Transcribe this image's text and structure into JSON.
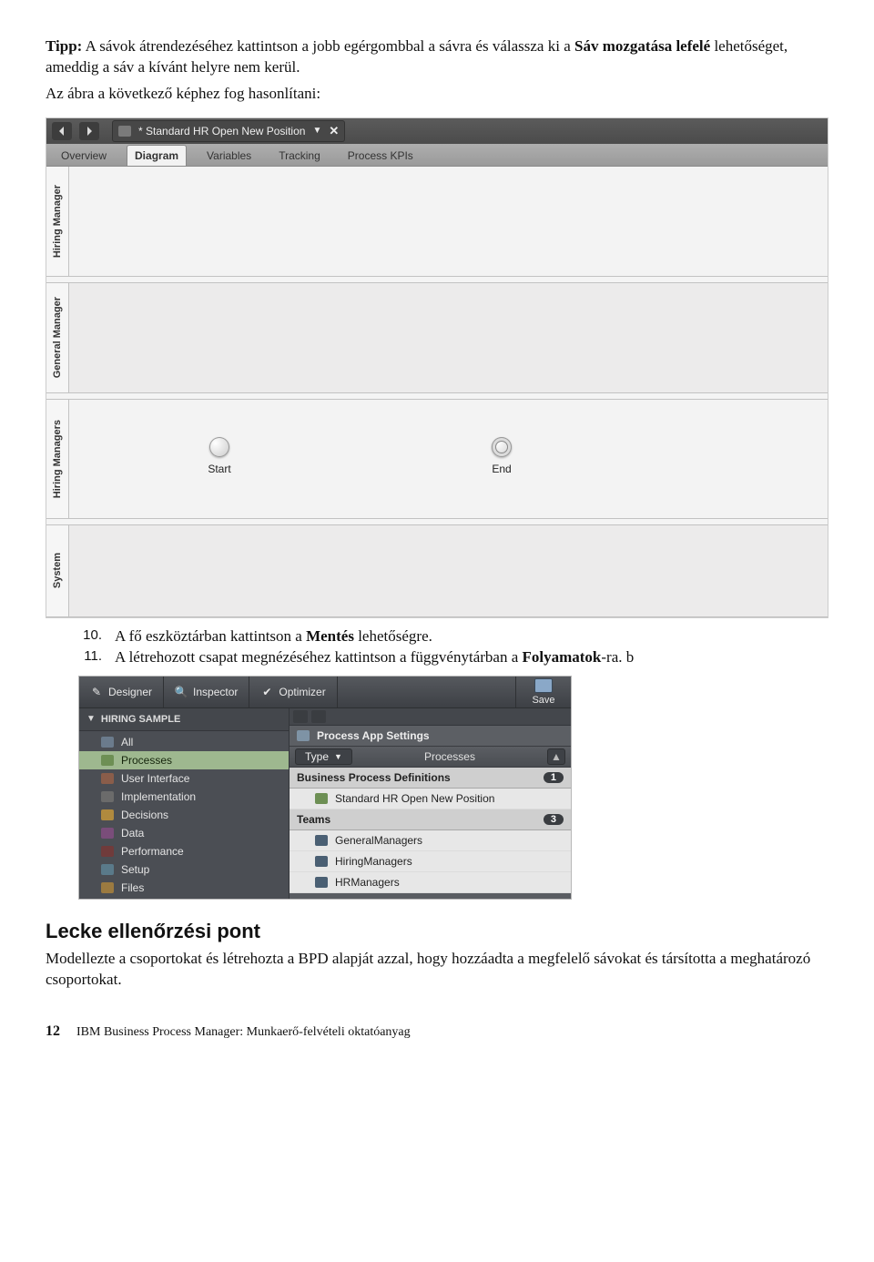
{
  "tip": {
    "label": "Tipp:",
    "before": "A sávok átrendezéséhez kattintson a jobb egérgombbal a sávra és válassza ki a ",
    "bold": "Sáv mozgatása lefelé",
    "after": " lehetőséget, ameddig a sáv a kívánt helyre nem kerül."
  },
  "intro": "Az ábra a következő képhez fog hasonlítani:",
  "shot1": {
    "tabTitle": "* Standard HR Open New Position",
    "subtabs": [
      "Overview",
      "Diagram",
      "Variables",
      "Tracking",
      "Process KPIs"
    ],
    "activeSubtab": "Diagram",
    "lanes": [
      "Hiring Manager",
      "General Manager",
      "Hiring Managers",
      "System"
    ],
    "nodes": {
      "start": "Start",
      "end": "End"
    }
  },
  "steps": [
    {
      "n": "10.",
      "before": "A fő eszköztárban kattintson a ",
      "bold": "Mentés",
      "after": " lehetőségre."
    },
    {
      "n": "11.",
      "before": "A létrehozott csapat megnézéséhez kattintson a függvénytárban a ",
      "bold": "Folyamatok",
      "after": "-ra. b"
    }
  ],
  "shot2": {
    "top": {
      "designer": "Designer",
      "inspector": "Inspector",
      "optimizer": "Optimizer",
      "save": "Save"
    },
    "lib": {
      "header": "HIRING SAMPLE",
      "items": [
        {
          "label": "All",
          "iconClass": "c-all"
        },
        {
          "label": "Processes",
          "iconClass": "c-proc",
          "selected": true
        },
        {
          "label": "User Interface",
          "iconClass": "c-ui"
        },
        {
          "label": "Implementation",
          "iconClass": "c-impl"
        },
        {
          "label": "Decisions",
          "iconClass": "c-dec"
        },
        {
          "label": "Data",
          "iconClass": "c-data"
        },
        {
          "label": "Performance",
          "iconClass": "c-perf"
        },
        {
          "label": "Setup",
          "iconClass": "c-setup"
        },
        {
          "label": "Files",
          "iconClass": "c-files"
        }
      ]
    },
    "right": {
      "settings": "Process App Settings",
      "typeLabel": "Type",
      "typeValue": "Processes",
      "groups": [
        {
          "title": "Business Process Definitions",
          "count": "1",
          "items": [
            {
              "label": "Standard HR Open New Position",
              "iconClass": "c-proc"
            }
          ]
        },
        {
          "title": "Teams",
          "count": "3",
          "items": [
            {
              "label": "GeneralManagers",
              "iconClass": "c-team"
            },
            {
              "label": "HiringManagers",
              "iconClass": "c-team"
            },
            {
              "label": "HRManagers",
              "iconClass": "c-team"
            }
          ]
        }
      ]
    }
  },
  "section": {
    "heading": "Lecke ellenőrzési pont",
    "body": "Modellezte a csoportokat és létrehozta a BPD alapját azzal, hogy hozzáadta a megfelelő sávokat és társította a meghatározó csoportokat."
  },
  "footer": {
    "page": "12",
    "title": "IBM Business Process Manager: Munkaerő-felvételi oktatóanyag"
  }
}
